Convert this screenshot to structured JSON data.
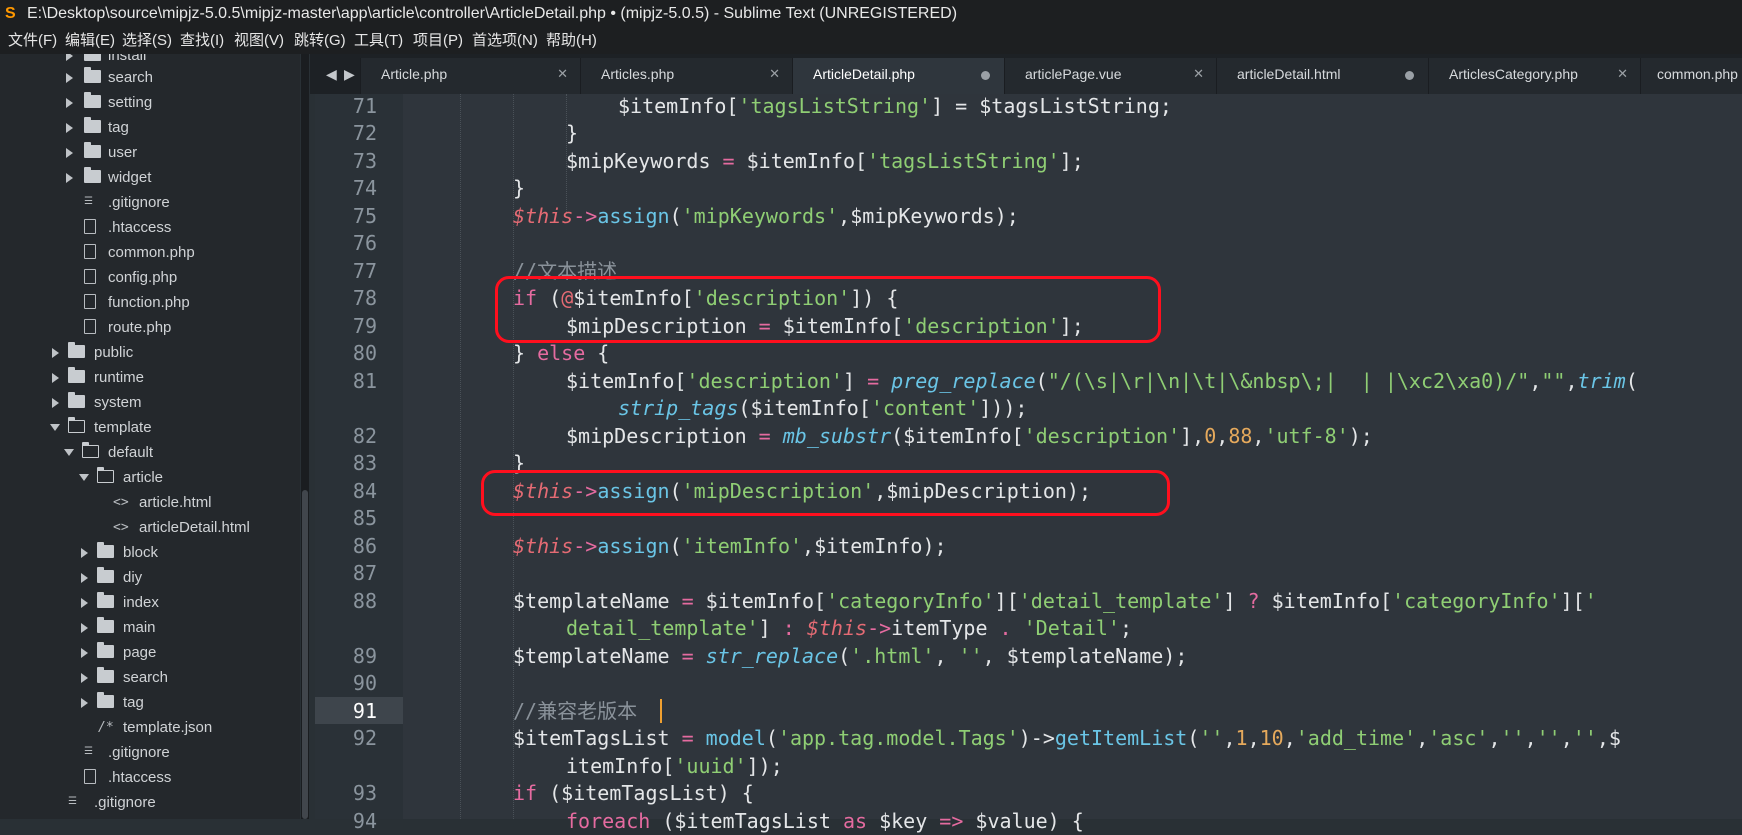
{
  "window": {
    "title": "E:\\Desktop\\source\\mipjz-5.0.5\\mipjz-master\\app\\article\\controller\\ArticleDetail.php • (mipjz-5.0.5) - Sublime Text (UNREGISTERED)",
    "icon": "sublime-logo-icon"
  },
  "menu": [
    "文件(F)",
    "编辑(E)",
    "选择(S)",
    "查找(I)",
    "视图(V)",
    "跳转(G)",
    "工具(T)",
    "项目(P)",
    "首选项(N)",
    "帮助(H)"
  ],
  "sidebar": {
    "items": [
      {
        "label": "install",
        "icon": "folder-icon"
      },
      {
        "label": "search",
        "icon": "folder-icon"
      },
      {
        "label": "setting",
        "icon": "folder-icon"
      },
      {
        "label": "tag",
        "icon": "folder-icon"
      },
      {
        "label": "user",
        "icon": "folder-icon"
      },
      {
        "label": "widget",
        "icon": "folder-icon"
      },
      {
        "label": ".gitignore",
        "icon": "text-lines-icon"
      },
      {
        "label": ".htaccess",
        "icon": "file-icon"
      },
      {
        "label": "common.php",
        "icon": "file-icon"
      },
      {
        "label": "config.php",
        "icon": "file-icon"
      },
      {
        "label": "function.php",
        "icon": "file-icon"
      },
      {
        "label": "route.php",
        "icon": "file-icon"
      },
      {
        "label": "public",
        "icon": "folder-icon"
      },
      {
        "label": "runtime",
        "icon": "folder-icon"
      },
      {
        "label": "system",
        "icon": "folder-icon"
      },
      {
        "label": "template",
        "icon": "folder-open-icon"
      },
      {
        "label": "default",
        "icon": "folder-open-icon"
      },
      {
        "label": "article",
        "icon": "folder-open-icon"
      },
      {
        "label": "article.html",
        "icon": "code-file-icon"
      },
      {
        "label": "articleDetail.html",
        "icon": "code-file-icon"
      },
      {
        "label": "block",
        "icon": "folder-icon"
      },
      {
        "label": "diy",
        "icon": "folder-icon"
      },
      {
        "label": "index",
        "icon": "folder-icon"
      },
      {
        "label": "main",
        "icon": "folder-icon"
      },
      {
        "label": "page",
        "icon": "folder-icon"
      },
      {
        "label": "search",
        "icon": "folder-icon"
      },
      {
        "label": "tag",
        "icon": "folder-icon"
      },
      {
        "label": "template.json",
        "icon": "comment-file-icon"
      },
      {
        "label": ".gitignore",
        "icon": "text-lines-icon"
      },
      {
        "label": ".htaccess",
        "icon": "file-icon"
      },
      {
        "label": ".gitignore",
        "icon": "text-lines-icon"
      }
    ]
  },
  "tabs": [
    {
      "label": "Article.php",
      "state": "close"
    },
    {
      "label": "Articles.php",
      "state": "close"
    },
    {
      "label": "ArticleDetail.php",
      "state": "modified",
      "active": true
    },
    {
      "label": "articlePage.vue",
      "state": "close"
    },
    {
      "label": "articleDetail.html",
      "state": "modified"
    },
    {
      "label": "ArticlesCategory.php",
      "state": "close"
    },
    {
      "label": "common.php",
      "state": "none"
    }
  ],
  "tab_nav": {
    "prev": "◀",
    "next": "▶"
  },
  "editor": {
    "current_line": "91",
    "line_numbers": [
      "71",
      "72",
      "73",
      "74",
      "75",
      "76",
      "77",
      "78",
      "79",
      "80",
      "81",
      "82",
      "83",
      "84",
      "85",
      "86",
      "87",
      "88",
      "89",
      "90",
      "91",
      "92",
      "93",
      "94"
    ],
    "code": {
      "l71": [
        "$itemInfo[",
        "'tagsListString'",
        "] = $tagsListString;"
      ],
      "l72": [
        "}"
      ],
      "l73": [
        "$mipKeywords ",
        "=",
        " $itemInfo[",
        "'tagsListString'",
        "];"
      ],
      "l74": [
        "}"
      ],
      "l75": [
        "$this",
        "->",
        "assign",
        "(",
        "'mipKeywords'",
        ",$mipKeywords);"
      ],
      "l77": [
        "//文本描述"
      ],
      "l78": [
        "if",
        " (",
        "@",
        "$itemInfo[",
        "'description'",
        "]) {"
      ],
      "l79": [
        "$mipDescription ",
        "=",
        " $itemInfo[",
        "'description'",
        "];"
      ],
      "l80": [
        "} ",
        "else",
        " {"
      ],
      "l81a": [
        "$itemInfo[",
        "'description'",
        "] ",
        "=",
        " ",
        "preg_replace",
        "(",
        "\"/(\\s|\\r|\\n|\\t|\\&nbsp\\;|  | |\\xc2\\xa0)/\"",
        ",",
        "\"\"",
        ",",
        "trim",
        "("
      ],
      "l81b": [
        "strip_tags",
        "($itemInfo[",
        "'content'",
        "]));"
      ],
      "l82": [
        "$mipDescription ",
        "=",
        " ",
        "mb_substr",
        "($itemInfo[",
        "'description'",
        "],",
        "0",
        ",",
        "88",
        ",",
        "'utf-8'",
        ");"
      ],
      "l83": [
        "}"
      ],
      "l84": [
        "$this",
        "->",
        "assign",
        "(",
        "'mipDescription'",
        ",$mipDescription);"
      ],
      "l86": [
        "$this",
        "->",
        "assign",
        "(",
        "'itemInfo'",
        ",$itemInfo);"
      ],
      "l88a": [
        "$templateName ",
        "=",
        " $itemInfo[",
        "'categoryInfo'",
        "][",
        "'detail_template'",
        "] ",
        "?",
        " $itemInfo[",
        "'categoryInfo'",
        "][",
        "'"
      ],
      "l88b": [
        "detail_template'",
        "] ",
        ":",
        " ",
        "$this",
        "->",
        "itemType ",
        ".",
        " ",
        "'Detail'",
        ";"
      ],
      "l89": [
        "$templateName ",
        "=",
        " ",
        "str_replace",
        "(",
        "'.html'",
        ", ",
        "''",
        ", $templateName);"
      ],
      "l91": [
        "//兼容老版本"
      ],
      "l92a": [
        "$itemTagsList ",
        "=",
        " ",
        "model",
        "(",
        "'app.tag.model.Tags'",
        ")->",
        "getItemList",
        "(",
        "''",
        ",",
        "1",
        ",",
        "10",
        ",",
        "'add_time'",
        ",",
        "'asc'",
        ",",
        "''",
        ",",
        "''",
        ",",
        "''",
        ",$"
      ],
      "l92b": [
        "itemInfo[",
        "'uuid'",
        "]);"
      ],
      "l93": [
        "if",
        " ($itemTagsList) {"
      ],
      "l94": [
        "foreach",
        " ($itemTagsList ",
        "as",
        " $key ",
        "=>",
        " $value) {"
      ]
    }
  },
  "annotations": [
    {
      "label": "highlight-box-description-if"
    },
    {
      "label": "highlight-box-assign-mipDescription"
    }
  ],
  "colors": {
    "accent": "#ff9800",
    "highlight": "#ff0f1e",
    "keyword": "#e56ba0",
    "string": "#8fce74",
    "function": "#6ac5e6",
    "number": "#e5a95c",
    "comment": "#8a929a"
  }
}
